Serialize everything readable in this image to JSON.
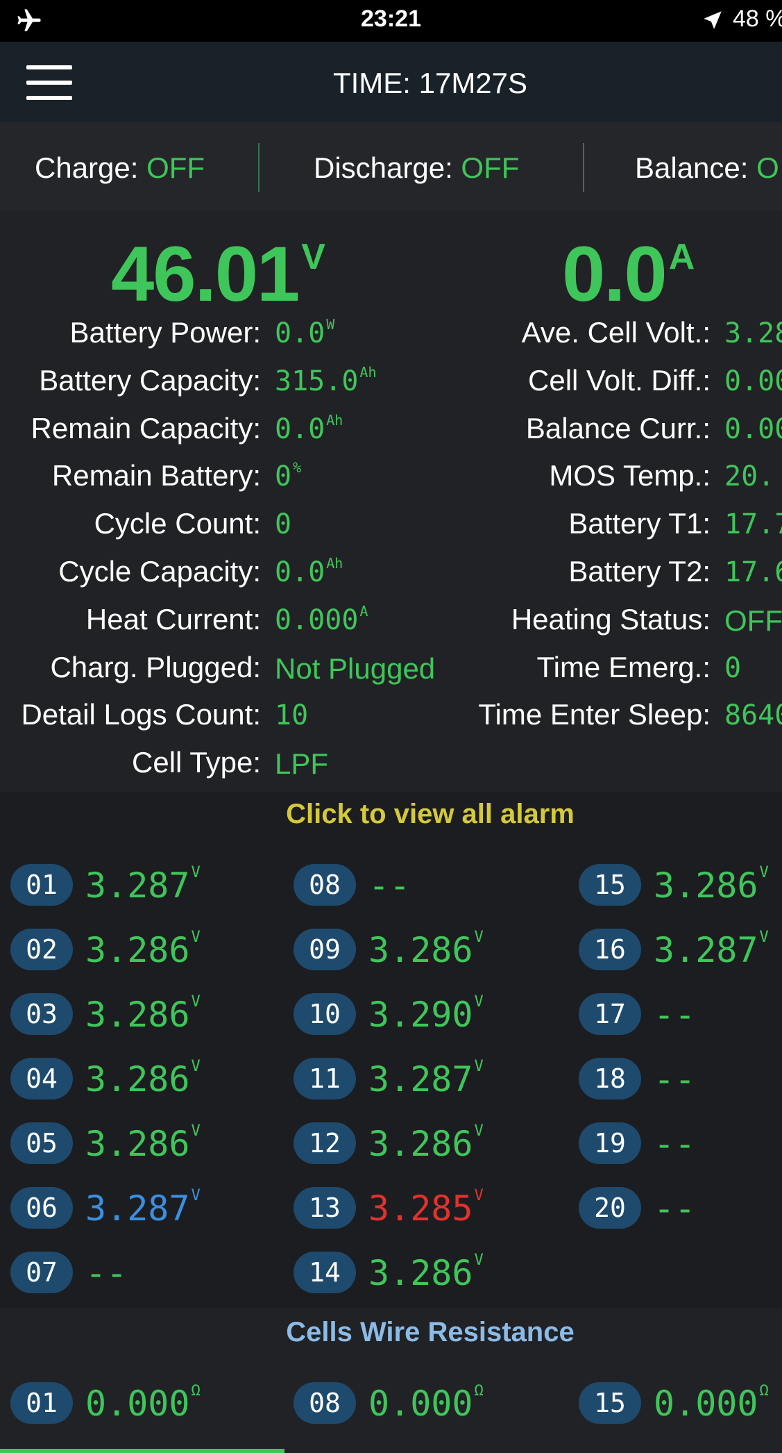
{
  "status_bar": {
    "time": "23:21",
    "battery": "48 %"
  },
  "nav": {
    "title": "TIME: 17M27S"
  },
  "switches": [
    {
      "label": "Charge: ",
      "value": "OFF"
    },
    {
      "label": "Discharge: ",
      "value": "OFF"
    },
    {
      "label": "Balance: ",
      "value": "O"
    }
  ],
  "main": {
    "voltage": {
      "value": "46.01",
      "unit": "V"
    },
    "current": {
      "value": "0.0",
      "unit": "A"
    }
  },
  "left_rows": [
    {
      "label": "Battery Power:",
      "value": "0.0",
      "unit": "W"
    },
    {
      "label": "Battery Capacity:",
      "value": "315.0",
      "unit": "Ah"
    },
    {
      "label": "Remain Capacity:",
      "value": "0.0",
      "unit": "Ah"
    },
    {
      "label": "Remain Battery:",
      "value": "0",
      "unit": "%"
    },
    {
      "label": "Cycle Count:",
      "value": "0",
      "unit": ""
    },
    {
      "label": "Cycle Capacity:",
      "value": "0.0",
      "unit": "Ah"
    },
    {
      "label": "Heat Current:",
      "value": "0.000",
      "unit": "A"
    },
    {
      "label": "Charg. Plugged:",
      "value": "Not Plugged",
      "unit": ""
    },
    {
      "label": "Detail Logs Count:",
      "value": "10",
      "unit": ""
    },
    {
      "label": "Cell Type:",
      "value": "LPF",
      "unit": ""
    }
  ],
  "right_rows": [
    {
      "label": "Ave. Cell Volt.:",
      "value": "3.28"
    },
    {
      "label": "Cell Volt. Diff.:",
      "value": "0.00"
    },
    {
      "label": "Balance Curr.:",
      "value": "0.00"
    },
    {
      "label": "MOS Temp.:",
      "value": "20."
    },
    {
      "label": "Battery T1:",
      "value": "17.7"
    },
    {
      "label": "Battery T2:",
      "value": "17.6"
    },
    {
      "label": "Heating Status:",
      "value": "OFF"
    },
    {
      "label": "Time Emerg.:",
      "value": "0"
    },
    {
      "label": "Time Enter Sleep:",
      "value": "8640"
    }
  ],
  "alarm_link": "Click to view all alarm",
  "cells": [
    {
      "id": "01",
      "value": "3.287",
      "unit": "V",
      "color": "#3fc65a"
    },
    {
      "id": "02",
      "value": "3.286",
      "unit": "V",
      "color": "#3fc65a"
    },
    {
      "id": "03",
      "value": "3.286",
      "unit": "V",
      "color": "#3fc65a"
    },
    {
      "id": "04",
      "value": "3.286",
      "unit": "V",
      "color": "#3fc65a"
    },
    {
      "id": "05",
      "value": "3.286",
      "unit": "V",
      "color": "#3fc65a"
    },
    {
      "id": "06",
      "value": "3.287",
      "unit": "V",
      "color": "#3b8fe0"
    },
    {
      "id": "07",
      "value": "--",
      "unit": "",
      "color": "#3fc65a"
    },
    {
      "id": "08",
      "value": "--",
      "unit": "",
      "color": "#3fc65a"
    },
    {
      "id": "09",
      "value": "3.286",
      "unit": "V",
      "color": "#3fc65a"
    },
    {
      "id": "10",
      "value": "3.290",
      "unit": "V",
      "color": "#3fc65a"
    },
    {
      "id": "11",
      "value": "3.287",
      "unit": "V",
      "color": "#3fc65a"
    },
    {
      "id": "12",
      "value": "3.286",
      "unit": "V",
      "color": "#3fc65a"
    },
    {
      "id": "13",
      "value": "3.285",
      "unit": "V",
      "color": "#e2322d"
    },
    {
      "id": "14",
      "value": "3.286",
      "unit": "V",
      "color": "#3fc65a"
    },
    {
      "id": "15",
      "value": "3.286",
      "unit": "V",
      "color": "#3fc65a"
    },
    {
      "id": "16",
      "value": "3.287",
      "unit": "V",
      "color": "#3fc65a"
    },
    {
      "id": "17",
      "value": "--",
      "unit": "",
      "color": "#3fc65a"
    },
    {
      "id": "18",
      "value": "--",
      "unit": "",
      "color": "#3fc65a"
    },
    {
      "id": "19",
      "value": "--",
      "unit": "",
      "color": "#3fc65a"
    },
    {
      "id": "20",
      "value": "--",
      "unit": "",
      "color": "#3fc65a"
    }
  ],
  "resistance_title": "Cells Wire Resistance",
  "resistances": [
    {
      "id": "01",
      "value": "0.000",
      "unit": "Ω"
    },
    {
      "id": "08",
      "value": "0.000",
      "unit": "Ω"
    },
    {
      "id": "15",
      "value": "0.000",
      "unit": "Ω"
    }
  ],
  "colors": {
    "accent_green": "#3fc65a",
    "alarm_yellow": "#d4c93a",
    "badge_blue": "#1e4a6e",
    "title_blue": "#8bbbe6"
  }
}
